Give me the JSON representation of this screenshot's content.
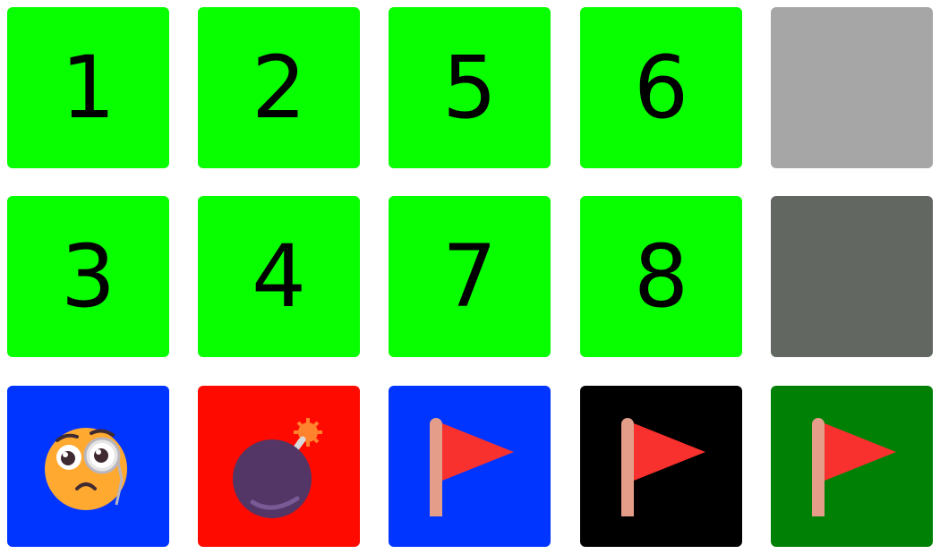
{
  "board": {
    "rows": [
      [
        {
          "type": "number",
          "label": "1",
          "color": "#08FF00"
        },
        {
          "type": "number",
          "label": "2",
          "color": "#08FF00"
        },
        {
          "type": "number",
          "label": "5",
          "color": "#08FF00"
        },
        {
          "type": "number",
          "label": "6",
          "color": "#08FF00"
        },
        {
          "type": "blank",
          "color": "#A6A6A6"
        }
      ],
      [
        {
          "type": "number",
          "label": "3",
          "color": "#08FF00"
        },
        {
          "type": "number",
          "label": "4",
          "color": "#08FF00"
        },
        {
          "type": "number",
          "label": "7",
          "color": "#08FF00"
        },
        {
          "type": "number",
          "label": "8",
          "color": "#08FF00"
        },
        {
          "type": "blank",
          "color": "#626762"
        }
      ],
      [
        {
          "type": "icon",
          "icon": "monocle-face-icon",
          "color": "#0035FF"
        },
        {
          "type": "icon",
          "icon": "bomb-icon",
          "color": "#FF0A00"
        },
        {
          "type": "icon",
          "icon": "flag-icon",
          "color": "#0035FF"
        },
        {
          "type": "icon",
          "icon": "flag-icon",
          "color": "#000000"
        },
        {
          "type": "icon",
          "icon": "flag-icon",
          "color": "#008106"
        }
      ]
    ]
  }
}
